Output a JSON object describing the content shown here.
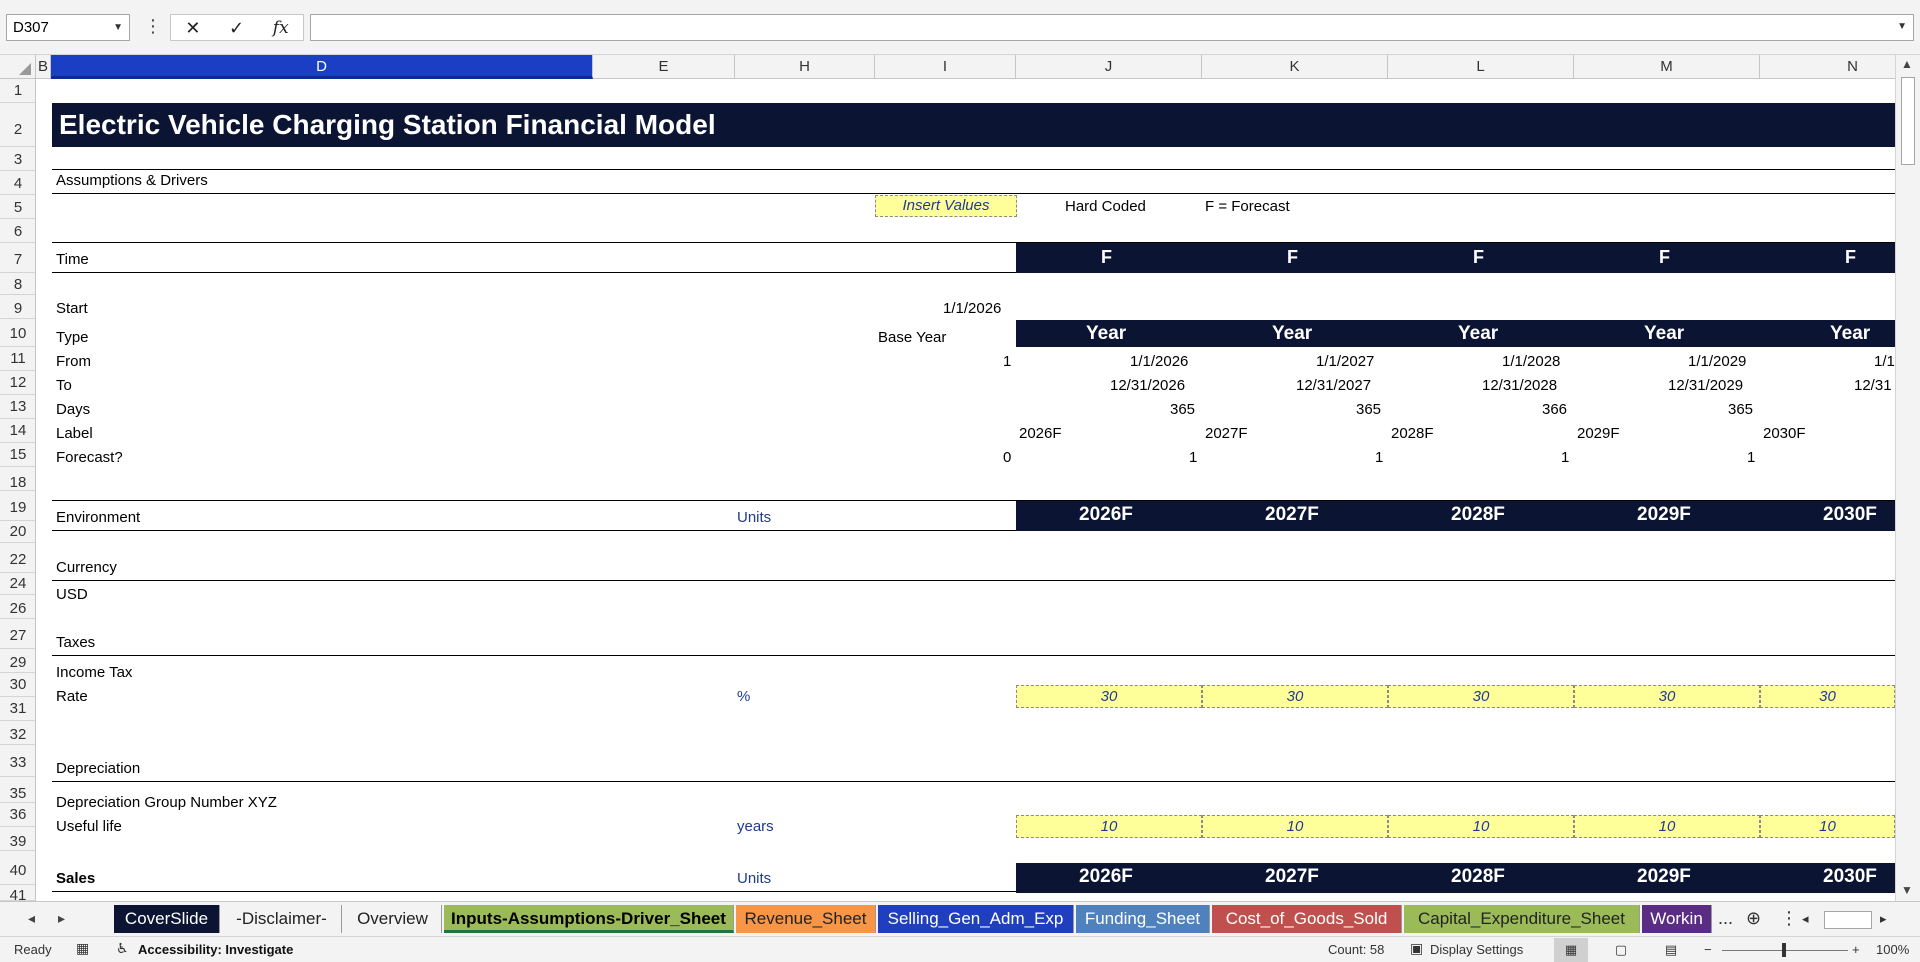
{
  "formula_bar": {
    "name_box": "D307",
    "dots": "⋮",
    "cancel_icon": "✕",
    "confirm_icon": "✓",
    "fx": "fx",
    "formula": ""
  },
  "columns": [
    "B",
    "D",
    "E",
    "H",
    "I",
    "J",
    "K",
    "L",
    "M",
    "N"
  ],
  "rows": [
    "1",
    "2",
    "3",
    "4",
    "5",
    "6",
    "7",
    "8",
    "9",
    "10",
    "11",
    "12",
    "13",
    "14",
    "15",
    "18",
    "19",
    "20",
    "22",
    "24",
    "26",
    "27",
    "29",
    "30",
    "31",
    "32",
    "33",
    "35",
    "36",
    "39",
    "40",
    "41"
  ],
  "sheet": {
    "title": "Electric Vehicle Charging Station Financial Model",
    "section_assumptions": "Assumptions & Drivers",
    "legend": {
      "insert_values": "Insert Values",
      "hard_coded": "Hard Coded",
      "forecast": "F = Forecast"
    },
    "time": {
      "label": "Time",
      "flags": [
        "F",
        "F",
        "F",
        "F",
        "F"
      ],
      "start_label": "Start",
      "start_value": "1/1/2026",
      "type_label": "Type",
      "base_year": "Base Year",
      "type_values": [
        "Year",
        "Year",
        "Year",
        "Year",
        "Year"
      ],
      "from_label": "From",
      "from_base": "1",
      "from_values": [
        "1/1/2026",
        "1/1/2027",
        "1/1/2028",
        "1/1/2029",
        "1/1"
      ],
      "to_label": "To",
      "to_values": [
        "12/31/2026",
        "12/31/2027",
        "12/31/2028",
        "12/31/2029",
        "12/31"
      ],
      "days_label": "Days",
      "days_values": [
        "365",
        "365",
        "366",
        "365"
      ],
      "label_label": "Label",
      "label_values": [
        "2026F",
        "2027F",
        "2028F",
        "2029F",
        "2030F"
      ],
      "forecast_label": "Forecast?",
      "forecast_base": "0",
      "forecast_values": [
        "1",
        "1",
        "1",
        "1"
      ]
    },
    "environment": {
      "label": "Environment",
      "units": "Units",
      "years": [
        "2026F",
        "2027F",
        "2028F",
        "2029F",
        "2030F"
      ]
    },
    "currency": {
      "label": "Currency",
      "value": "USD"
    },
    "taxes": {
      "label": "Taxes",
      "income_tax": "Income Tax",
      "rate_label": "Rate",
      "rate_unit": "%",
      "rate_values": [
        "30",
        "30",
        "30",
        "30",
        "30"
      ]
    },
    "depreciation": {
      "label": "Depreciation",
      "group": "Depreciation Group Number XYZ",
      "useful_life_label": "Useful life",
      "useful_life_unit": "years",
      "useful_life_values": [
        "10",
        "10",
        "10",
        "10",
        "10"
      ]
    },
    "sales": {
      "label": "Sales",
      "units": "Units",
      "years": [
        "2026F",
        "2027F",
        "2028F",
        "2029F",
        "2030F"
      ]
    }
  },
  "tabs": [
    {
      "label": "CoverSlide",
      "bg": "#0b1533",
      "fg": "#ffffff"
    },
    {
      "label": "-Disclaimer-",
      "bg": "#f3f3f3",
      "fg": "#222222"
    },
    {
      "label": "Overview",
      "bg": "#f3f3f3",
      "fg": "#222222"
    },
    {
      "label": "Inputs-Assumptions-Driver_Sheet",
      "bg": "#9bbb59",
      "fg": "#000000"
    },
    {
      "label": "Revenue_Sheet",
      "bg": "#f79646",
      "fg": "#222222"
    },
    {
      "label": "Selling_Gen_Adm_Exp",
      "bg": "#1f3fbf",
      "fg": "#ffffff"
    },
    {
      "label": "Funding_Sheet",
      "bg": "#4f81bd",
      "fg": "#ffffff"
    },
    {
      "label": "Cost_of_Goods_Sold",
      "bg": "#c0504d",
      "fg": "#ffffff"
    },
    {
      "label": "Capital_Expenditure_Sheet",
      "bg": "#9bbb59",
      "fg": "#222222"
    },
    {
      "label": "Workin",
      "bg": "#5b2c83",
      "fg": "#ffffff"
    }
  ],
  "tabs_more": "...",
  "status": {
    "ready": "Ready",
    "accessibility": "Accessibility: Investigate",
    "count": "Count: 58",
    "display_settings": "Display Settings",
    "zoom": "100%",
    "zoom_level": 1.0
  },
  "icons": {
    "prev_sheet": "arrow-left-icon",
    "next_sheet": "arrow-right-icon",
    "new_sheet": "plus-circle-icon",
    "macro": "record-macro-icon",
    "accessibility": "accessibility-icon",
    "display": "display-settings-icon",
    "normal_view": "normal-view-icon",
    "page_layout": "page-layout-icon",
    "page_break": "page-break-icon"
  }
}
